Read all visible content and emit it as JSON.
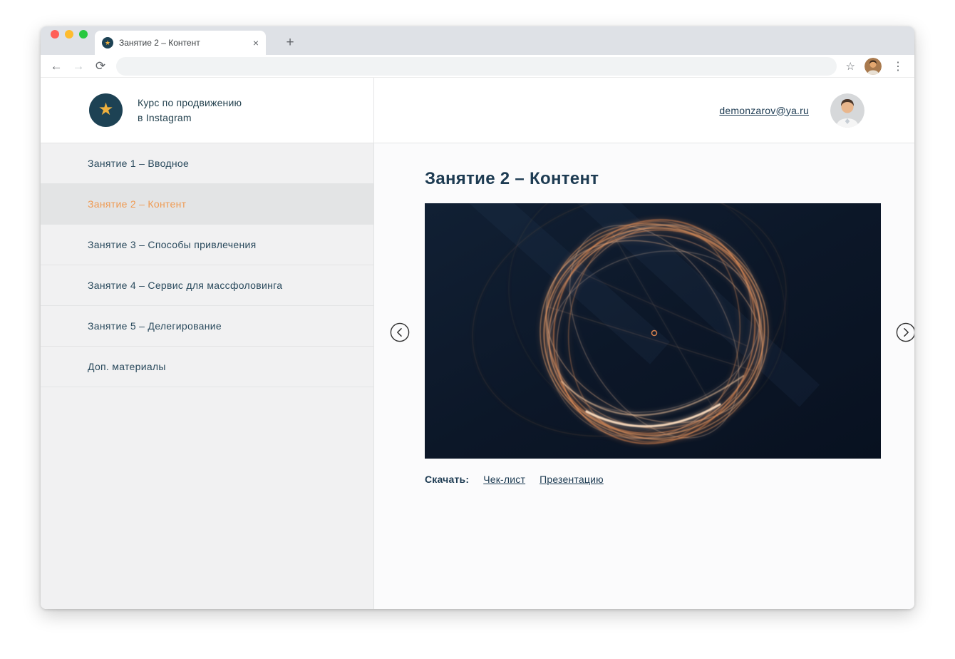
{
  "browser": {
    "tab_title": "Занятие 2 – Контент"
  },
  "icons": {
    "star": "★",
    "back": "←",
    "forward": "→",
    "reload": "⟳",
    "bookmark": "☆",
    "overflow_menu": "⋮",
    "close_tab": "×",
    "new_tab": "+"
  },
  "header": {
    "course_title_line1": "Курс по продвижению",
    "course_title_line2": "в Instagram",
    "email": "demonzarov@ya.ru"
  },
  "sidebar": {
    "items": [
      {
        "label": "Занятие 1 – Вводное",
        "active": false
      },
      {
        "label": "Занятие 2 – Контент",
        "active": true
      },
      {
        "label": "Занятие 3 – Способы привлечения",
        "active": false
      },
      {
        "label": "Занятие 4 – Сервис для массфоловинга",
        "active": false
      },
      {
        "label": "Занятие 5 – Делегирование",
        "active": false
      },
      {
        "label": "Доп. материалы",
        "active": false
      }
    ]
  },
  "main": {
    "title": "Занятие 2 – Контент",
    "download_label": "Скачать:",
    "downloads": [
      {
        "label": "Чек-лист"
      },
      {
        "label": "Презентацию"
      }
    ]
  },
  "colors": {
    "accent_orange": "#ef9b54",
    "text_navy": "#1d3b52",
    "sidebar_bg": "#f1f1f2",
    "sidebar_active_bg": "#e3e4e5",
    "video_bg": "#0c1728"
  }
}
